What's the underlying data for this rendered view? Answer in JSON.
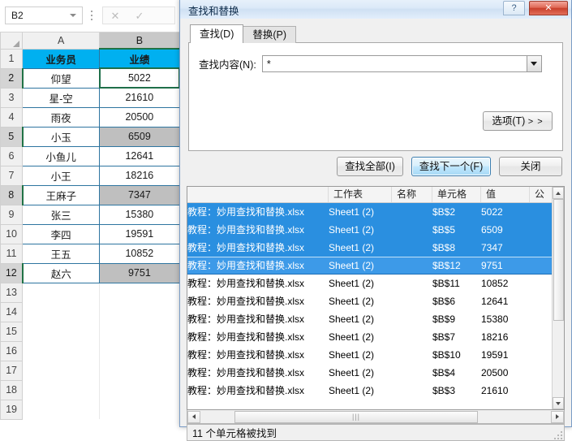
{
  "excel": {
    "name_box": {
      "value": "B2",
      "dropdown_icon": "chevron-down-icon"
    },
    "formula_bar": {
      "cancel_icon": "cancel-x-icon",
      "confirm_icon": "confirm-check-icon",
      "insert_function_icon": "grip-dots-icon"
    },
    "columns": [
      {
        "letter": "A",
        "active": false
      },
      {
        "letter": "B",
        "active": true
      }
    ],
    "rows": [
      {
        "num": "1",
        "a": "业务员",
        "b": "业绩",
        "style": "header",
        "hl": false
      },
      {
        "num": "2",
        "a": "仰望",
        "b": "5022",
        "style": "active",
        "hl": true
      },
      {
        "num": "3",
        "a": "星-空",
        "b": "21610",
        "style": "normal",
        "hl": false
      },
      {
        "num": "4",
        "a": "雨夜",
        "b": "20500",
        "style": "normal",
        "hl": false
      },
      {
        "num": "5",
        "a": "小玉",
        "b": "6509",
        "style": "selected",
        "hl": true
      },
      {
        "num": "6",
        "a": "小鱼儿",
        "b": "12641",
        "style": "normal",
        "hl": false
      },
      {
        "num": "7",
        "a": "小王",
        "b": "18216",
        "style": "normal",
        "hl": false
      },
      {
        "num": "8",
        "a": "王麻子",
        "b": "7347",
        "style": "selected",
        "hl": true
      },
      {
        "num": "9",
        "a": "张三",
        "b": "15380",
        "style": "normal",
        "hl": false
      },
      {
        "num": "10",
        "a": "李四",
        "b": "19591",
        "style": "normal",
        "hl": false
      },
      {
        "num": "11",
        "a": "王五",
        "b": "10852",
        "style": "normal",
        "hl": false
      },
      {
        "num": "12",
        "a": "赵六",
        "b": "9751",
        "style": "selected",
        "hl": true
      },
      {
        "num": "13",
        "a": "",
        "b": "",
        "style": "empty",
        "hl": false
      },
      {
        "num": "14",
        "a": "",
        "b": "",
        "style": "empty",
        "hl": false
      },
      {
        "num": "15",
        "a": "",
        "b": "",
        "style": "empty",
        "hl": false
      },
      {
        "num": "16",
        "a": "",
        "b": "",
        "style": "empty",
        "hl": false
      },
      {
        "num": "17",
        "a": "",
        "b": "",
        "style": "empty",
        "hl": false
      },
      {
        "num": "18",
        "a": "",
        "b": "",
        "style": "empty",
        "hl": false
      },
      {
        "num": "19",
        "a": "",
        "b": "",
        "style": "empty",
        "hl": false
      }
    ]
  },
  "dialog": {
    "title": "查找和替换",
    "help_label": "?",
    "close_label": "✕",
    "tabs": [
      {
        "label": "查找(D)",
        "active": true
      },
      {
        "label": "替换(P)",
        "active": false
      }
    ],
    "find_what_label": "查找内容(N):",
    "find_what_value": "*",
    "combo_arrow_icon": "chevron-down-icon",
    "options_label": "选项(T)",
    "options_arrows": "> >",
    "buttons": {
      "find_all": "查找全部(I)",
      "find_next": "查找下一个(F)",
      "close": "关闭"
    },
    "results": {
      "headers": {
        "workbook": "",
        "sheet": "工作表",
        "name": "名称",
        "cell": "单元格",
        "value": "值",
        "formula": "公"
      },
      "rows": [
        {
          "workbook": "教程：妙用查找和替换.xlsx",
          "sheet": "Sheet1 (2)",
          "name": "",
          "cell": "$B$2",
          "value": "5022",
          "formula": "",
          "selected": true,
          "current": false
        },
        {
          "workbook": "教程：妙用查找和替换.xlsx",
          "sheet": "Sheet1 (2)",
          "name": "",
          "cell": "$B$5",
          "value": "6509",
          "formula": "",
          "selected": true,
          "current": false
        },
        {
          "workbook": "教程：妙用查找和替换.xlsx",
          "sheet": "Sheet1 (2)",
          "name": "",
          "cell": "$B$8",
          "value": "7347",
          "formula": "",
          "selected": true,
          "current": false
        },
        {
          "workbook": "教程：妙用查找和替换.xlsx",
          "sheet": "Sheet1 (2)",
          "name": "",
          "cell": "$B$12",
          "value": "9751",
          "formula": "",
          "selected": true,
          "current": true
        },
        {
          "workbook": "教程：妙用查找和替换.xlsx",
          "sheet": "Sheet1 (2)",
          "name": "",
          "cell": "$B$11",
          "value": "10852",
          "formula": "",
          "selected": false,
          "current": false
        },
        {
          "workbook": "教程：妙用查找和替换.xlsx",
          "sheet": "Sheet1 (2)",
          "name": "",
          "cell": "$B$6",
          "value": "12641",
          "formula": "",
          "selected": false,
          "current": false
        },
        {
          "workbook": "教程：妙用查找和替换.xlsx",
          "sheet": "Sheet1 (2)",
          "name": "",
          "cell": "$B$9",
          "value": "15380",
          "formula": "",
          "selected": false,
          "current": false
        },
        {
          "workbook": "教程：妙用查找和替换.xlsx",
          "sheet": "Sheet1 (2)",
          "name": "",
          "cell": "$B$7",
          "value": "18216",
          "formula": "",
          "selected": false,
          "current": false
        },
        {
          "workbook": "教程：妙用查找和替换.xlsx",
          "sheet": "Sheet1 (2)",
          "name": "",
          "cell": "$B$10",
          "value": "19591",
          "formula": "",
          "selected": false,
          "current": false
        },
        {
          "workbook": "教程：妙用查找和替换.xlsx",
          "sheet": "Sheet1 (2)",
          "name": "",
          "cell": "$B$4",
          "value": "20500",
          "formula": "",
          "selected": false,
          "current": false
        },
        {
          "workbook": "教程：妙用查找和替换.xlsx",
          "sheet": "Sheet1 (2)",
          "name": "",
          "cell": "$B$3",
          "value": "21610",
          "formula": "",
          "selected": false,
          "current": false
        }
      ]
    },
    "status": "11 个单元格被找到",
    "scrollbar": {
      "left_arrow_icon": "arrow-left-icon",
      "right_arrow_icon": "arrow-right-icon",
      "up_arrow_icon": "arrow-up-icon",
      "down_arrow_icon": "arrow-down-icon",
      "thumb_grip_icon": "grip-icon"
    }
  },
  "colors": {
    "header_fill": "#00b0f0",
    "selection_fill": "#bfbfbf",
    "list_selection": "#2a8fe0",
    "excel_green": "#217346"
  }
}
